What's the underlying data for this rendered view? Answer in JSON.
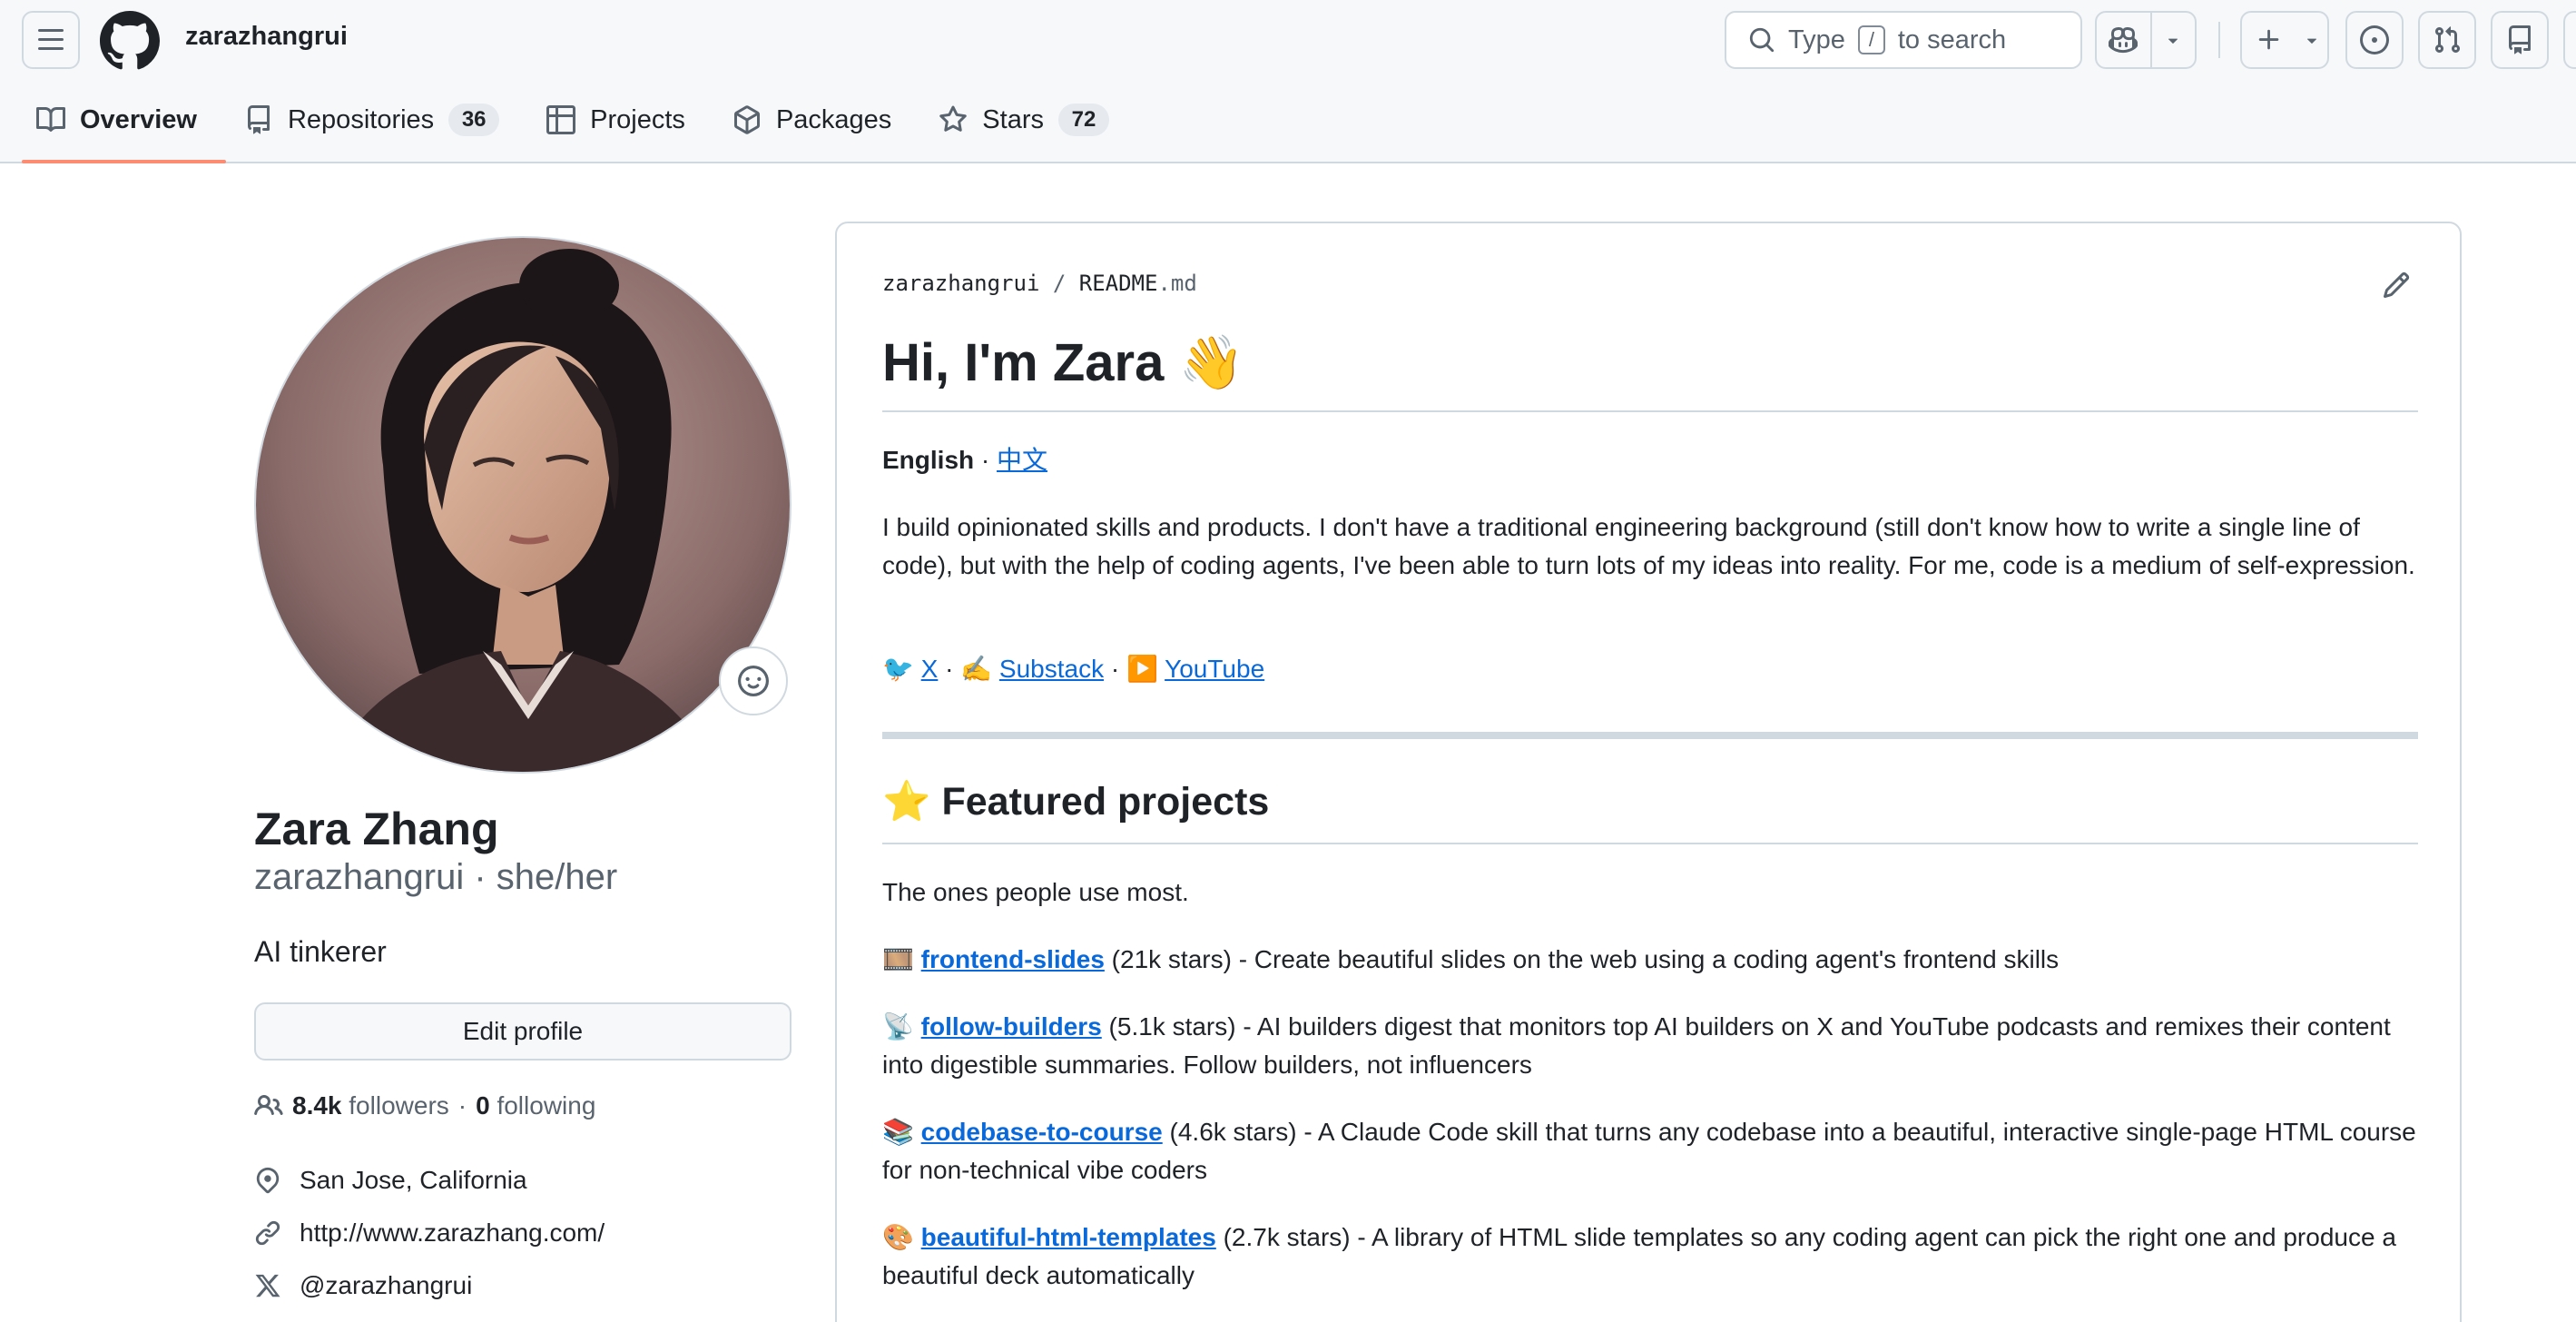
{
  "header": {
    "username": "zarazhangrui",
    "search": {
      "prefix": "Type",
      "key": "/",
      "suffix": "to search"
    }
  },
  "tabs": [
    {
      "label": "Overview",
      "count": null,
      "active": true
    },
    {
      "label": "Repositories",
      "count": "36"
    },
    {
      "label": "Projects",
      "count": null
    },
    {
      "label": "Packages",
      "count": null
    },
    {
      "label": "Stars",
      "count": "72"
    }
  ],
  "profile": {
    "name": "Zara Zhang",
    "handle": "zarazhangrui · she/her",
    "bio": "AI tinkerer",
    "edit_label": "Edit profile",
    "followers_count": "8.4k",
    "followers_label": "followers",
    "separator": "·",
    "following_count": "0",
    "following_label": "following",
    "location": "San Jose, California",
    "website": "http://www.zarazhang.com/",
    "twitter": "@zarazhangrui"
  },
  "readme": {
    "crumb_user": "zarazhangrui",
    "crumb_sep": "/",
    "crumb_file": "README",
    "crumb_ext": ".md",
    "title": "Hi, I'm Zara 👋",
    "lang_current": "English",
    "lang_sep": " · ",
    "lang_other": "中文",
    "intro": "I build opinionated skills and products. I don't have a traditional engineering background (still don't know how to write a single line of code), but with the help of coding agents, I've been able to turn lots of my ideas into reality. For me, code is a medium of self-expression.",
    "links": [
      {
        "icon": "🐦",
        "label": "X"
      },
      {
        "icon": "✍️",
        "label": "Substack"
      },
      {
        "icon": "▶️",
        "label": "YouTube"
      }
    ],
    "link_sep": " · ",
    "featured_title": "⭐ Featured projects",
    "featured_sub": "The ones people use most.",
    "projects": [
      {
        "icon": "🎞️",
        "name": "frontend-slides",
        "stars": " (21k stars)",
        "desc": " - Create beautiful slides on the web using a coding agent's frontend skills"
      },
      {
        "icon": "📡",
        "name": "follow-builders",
        "stars": " (5.1k stars)",
        "desc": " - AI builders digest that monitors top AI builders on X and YouTube podcasts and remixes their content into digestible summaries. Follow builders, not influencers"
      },
      {
        "icon": "📚",
        "name": "codebase-to-course",
        "stars": " (4.6k stars)",
        "desc": " - A Claude Code skill that turns any codebase into a beautiful, interactive single-page HTML course for non-technical vibe coders"
      },
      {
        "icon": "🎨",
        "name": "beautiful-html-templates",
        "stars": " (2.7k stars)",
        "desc": " - A library of HTML slide templates so any coding agent can pick the right one and produce a beautiful deck automatically"
      }
    ]
  }
}
